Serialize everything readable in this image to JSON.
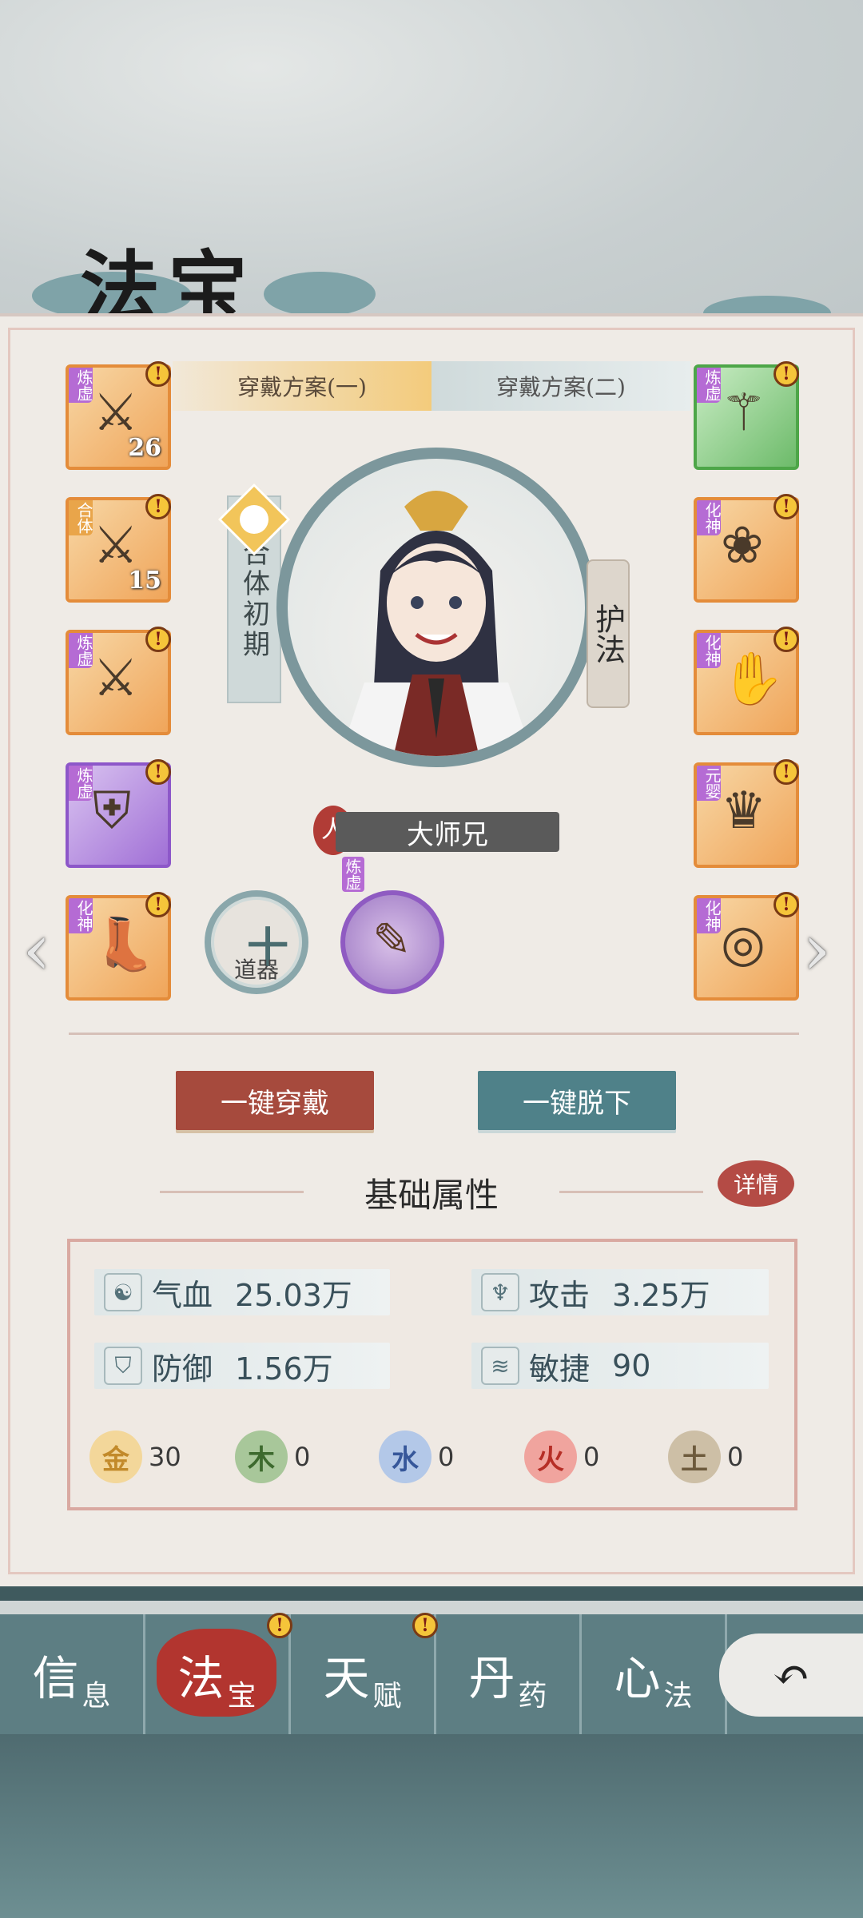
{
  "page_title": "法宝",
  "plan_tabs": [
    {
      "label": "穿戴方案(一)",
      "active": true
    },
    {
      "label": "穿戴方案(二)",
      "active": false
    }
  ],
  "left_slots": [
    {
      "tier": "炼虚",
      "count": "26",
      "color": "orange",
      "icon": "sword-icon"
    },
    {
      "tier": "合体",
      "count": "15",
      "color": "orange",
      "icon": "sword-icon"
    },
    {
      "tier": "炼虚",
      "count": "",
      "color": "orange",
      "icon": "sword-icon"
    },
    {
      "tier": "炼虚",
      "count": "",
      "color": "purple",
      "icon": "armor-icon"
    },
    {
      "tier": "化神",
      "count": "",
      "color": "orange",
      "icon": "boot-icon"
    }
  ],
  "right_slots": [
    {
      "tier": "炼虚",
      "color": "green",
      "icon": "fan-staff-icon"
    },
    {
      "tier": "化神",
      "color": "orange",
      "icon": "necklace-icon"
    },
    {
      "tier": "化神",
      "color": "orange",
      "icon": "gauntlet-icon"
    },
    {
      "tier": "元婴",
      "color": "orange",
      "icon": "crown-icon"
    },
    {
      "tier": "化神",
      "color": "orange",
      "icon": "ring-icon"
    }
  ],
  "character": {
    "realm": "合体初期",
    "guardian_tag": "护法",
    "name": "大师兄",
    "race_mark": "人"
  },
  "tool_slot": {
    "label": "道器",
    "plus": "十"
  },
  "artifact": {
    "tier": "炼虚",
    "icon": "talisman-icon"
  },
  "actions": {
    "equip_all": "一键穿戴",
    "unequip_all": "一键脱下"
  },
  "attributes": {
    "section_title": "基础属性",
    "detail_label": "详情",
    "stats": [
      {
        "label": "气血",
        "value": "25.03万",
        "icon": "blood-drop-icon"
      },
      {
        "label": "攻击",
        "value": "3.25万",
        "icon": "sword-hilt-icon"
      },
      {
        "label": "防御",
        "value": "1.56万",
        "icon": "shield-icon"
      },
      {
        "label": "敏捷",
        "value": "90",
        "icon": "wind-swirl-icon"
      }
    ],
    "elements": [
      {
        "name": "金",
        "value": "30",
        "color": "#e8b75a"
      },
      {
        "name": "木",
        "value": "0",
        "color": "#6f9b5a"
      },
      {
        "name": "水",
        "value": "0",
        "color": "#6a8ec8"
      },
      {
        "name": "火",
        "value": "0",
        "color": "#cf4a40"
      },
      {
        "name": "土",
        "value": "0",
        "color": "#8e7a60"
      }
    ]
  },
  "nav": [
    {
      "big": "信",
      "small": "息",
      "active": false,
      "alert": false
    },
    {
      "big": "法",
      "small": "宝",
      "active": true,
      "alert": true
    },
    {
      "big": "天",
      "small": "赋",
      "active": false,
      "alert": true
    },
    {
      "big": "丹",
      "small": "药",
      "active": false,
      "alert": false
    },
    {
      "big": "心",
      "small": "法",
      "active": false,
      "alert": false
    }
  ],
  "alert_symbol": "!",
  "arrows": {
    "left": "‹",
    "right": "›"
  },
  "back_symbol": "↶"
}
